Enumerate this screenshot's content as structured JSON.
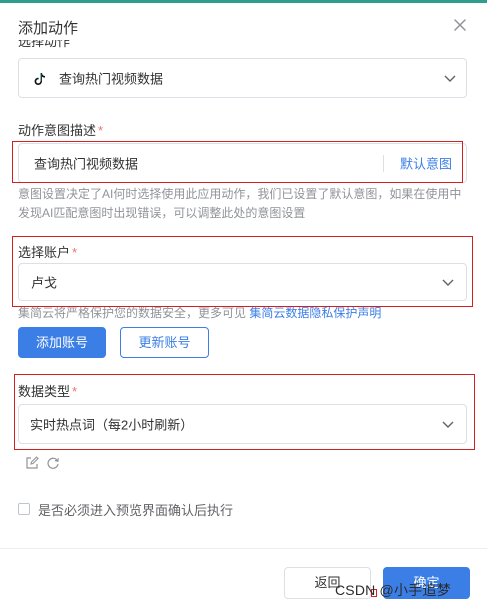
{
  "dialog": {
    "title": "添加动作",
    "close_icon": "close-icon"
  },
  "action_field": {
    "label_partial": "选择动作",
    "value": "查询热门视频数据",
    "icon": "tiktok-icon"
  },
  "intent_field": {
    "label": "动作意图描述",
    "required_mark": "*",
    "value": "查询热门视频数据",
    "default_link": "默认意图",
    "help_text": "意图设置决定了AI何时选择使用此应用动作，我们已设置了默认意图，如果在使用中发现AI匹配意图时出现错误，可以调整此处的意图设置"
  },
  "account_field": {
    "label": "选择账户",
    "required_mark": "*",
    "value": "卢戈",
    "notice_text": "集简云将严格保护您的数据安全，更多可见",
    "notice_link": "集简云数据隐私保护声明",
    "add_button": "添加账号",
    "update_button": "更新账号"
  },
  "data_type_field": {
    "label": "数据类型",
    "required_mark": "*",
    "value": "实时热点词（每2小时刷新）",
    "edit_icon": "edit-icon",
    "refresh_icon": "refresh-icon"
  },
  "confirm_checkbox": {
    "label": "是否必须进入预览界面确认后执行",
    "checked": false
  },
  "footer": {
    "back_button": "返回",
    "confirm_button": "确定"
  },
  "watermark": "CSDN @小手追梦",
  "colors": {
    "primary": "#3a7ee6",
    "required": "#f56c6c",
    "highlight_box": "#d42020",
    "top_bar": "#2f9e8f"
  }
}
